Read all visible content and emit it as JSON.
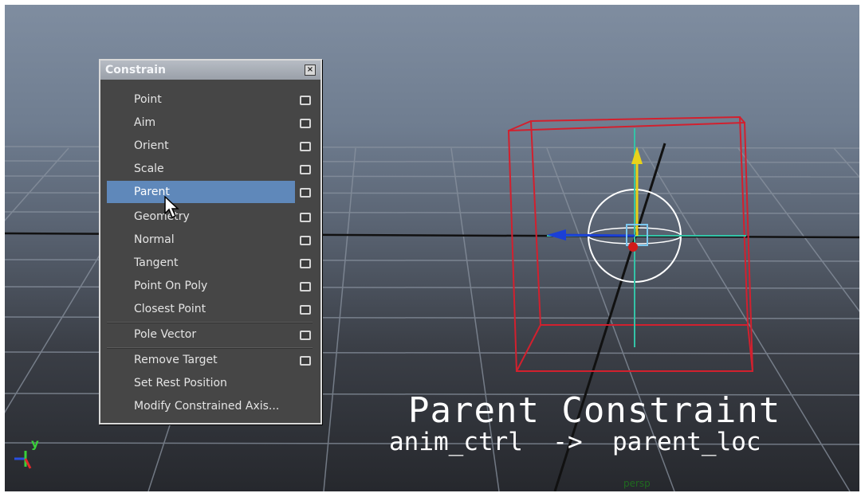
{
  "menu": {
    "title": "Constrain",
    "close_icon": "close-icon",
    "items": [
      {
        "label": "Point",
        "has_option": true
      },
      {
        "label": "Aim",
        "has_option": true
      },
      {
        "label": "Orient",
        "has_option": true
      },
      {
        "label": "Scale",
        "has_option": true
      },
      {
        "label": "Parent",
        "has_option": true,
        "highlighted": true
      },
      {
        "label": "Geometry",
        "has_option": true
      },
      {
        "label": "Normal",
        "has_option": true
      },
      {
        "label": "Tangent",
        "has_option": true
      },
      {
        "label": "Point On Poly",
        "has_option": true
      },
      {
        "label": "Closest Point",
        "has_option": true
      },
      {
        "label": "Pole Vector",
        "has_option": true
      },
      {
        "label": "Remove Target",
        "has_option": true
      },
      {
        "label": "Set Rest Position",
        "has_option": false
      },
      {
        "label": "Modify Constrained Axis...",
        "has_option": false
      }
    ]
  },
  "overlay": {
    "title": "Parent Constraint",
    "subtitle": "anim_ctrl  ->  parent_loc"
  },
  "viewport": {
    "camera_label": "persp",
    "axis_y_label": "y"
  },
  "colors": {
    "highlight": "#5f88ba",
    "bounding_box": "#d2202e",
    "manip_y": "#e8d21a",
    "manip_x_arrow": "#1a3fd6",
    "manip_z": "#34c3a7"
  }
}
